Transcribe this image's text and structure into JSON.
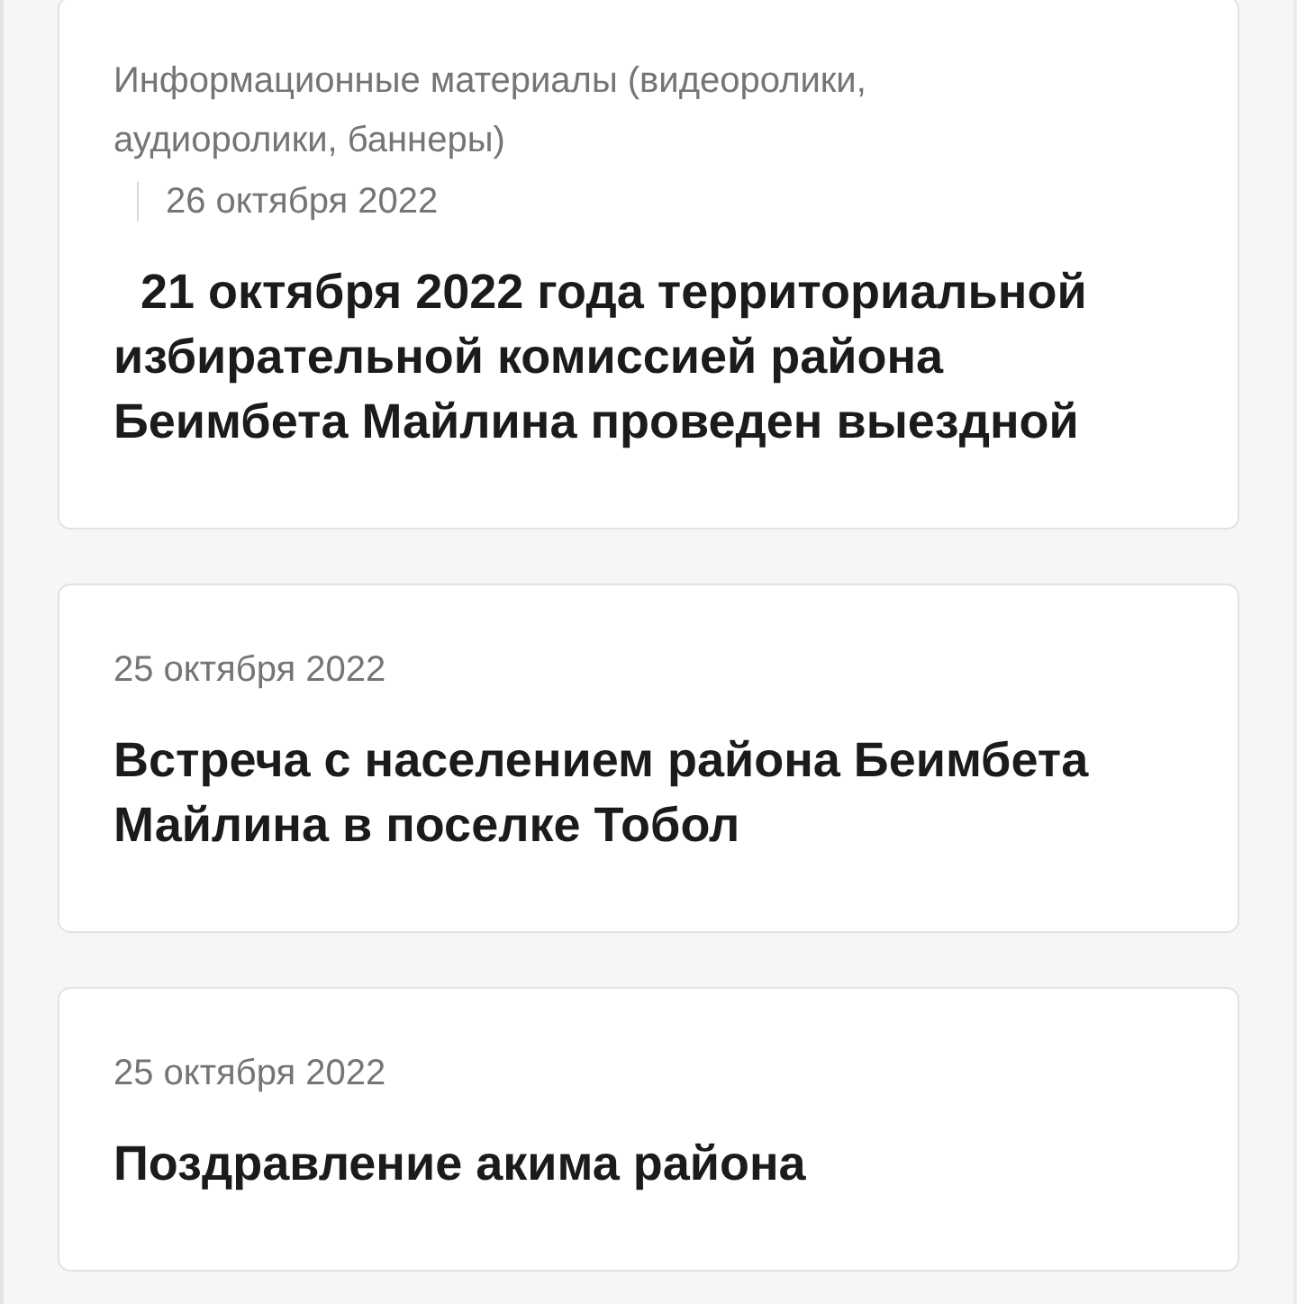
{
  "news_cards": [
    {
      "category": "Информационные материалы (видеоролики, аудиоролики, баннеры)",
      "date": "26 октября 2022",
      "title": "  21 октября 2022 года территориальной избирательной комиссией района Беимбета Майлина проведен выездной"
    },
    {
      "date": "25 октября 2022",
      "title": "Встреча с населением района Беимбета Майлина в поселке Тобол"
    },
    {
      "date": "25 октября 2022",
      "title": "Поздравление акима района"
    }
  ]
}
